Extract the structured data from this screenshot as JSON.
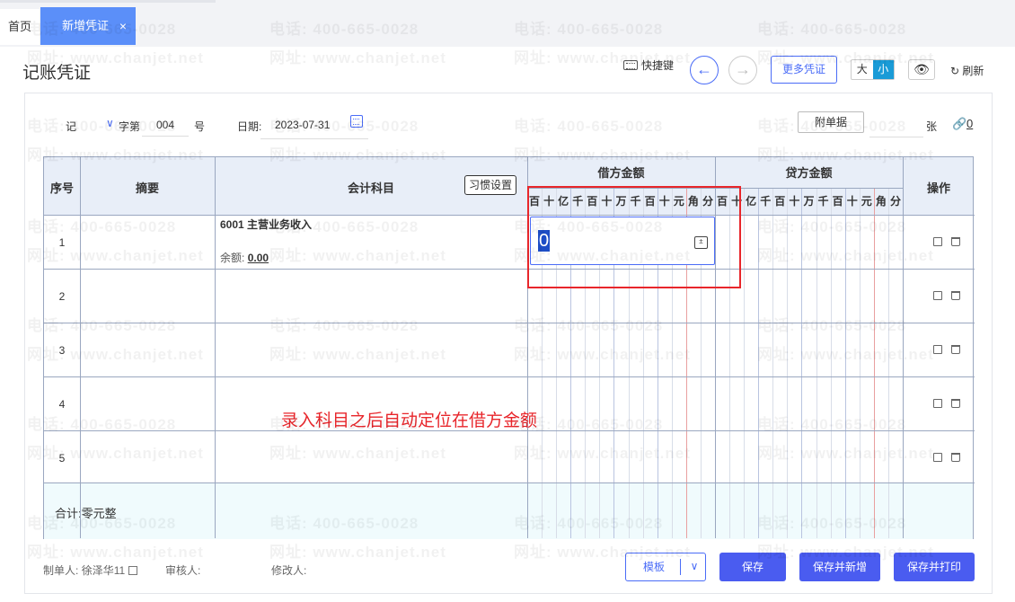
{
  "tabs": {
    "home": "首页",
    "active": "新增凭证",
    "close": "×"
  },
  "page": {
    "title": "记账凭证"
  },
  "toolbar": {
    "shortcut_label": "快捷键",
    "prev_icon": "←",
    "next_icon": "→",
    "more_vouchers": "更多凭证",
    "size_large": "大",
    "size_small": "小",
    "eye_icon": "👁",
    "refresh_label": "↻ 刷新"
  },
  "voucher": {
    "type": "记",
    "type_chevron": "∨",
    "zi_label": "字第",
    "number": "004",
    "hao_label": "号",
    "date_label": "日期:",
    "date": "2023-07-31",
    "attach_button": "附单据",
    "zhang_label": "张",
    "attach_icon": "🔗",
    "attach_count": "0"
  },
  "table": {
    "headers": {
      "seq": "序号",
      "summary": "摘要",
      "subject": "会计科目",
      "debit": "借方金额",
      "credit": "贷方金额",
      "ops": "操作",
      "habit_button": "习惯设置"
    },
    "digits": [
      "百",
      "十",
      "亿",
      "千",
      "百",
      "十",
      "万",
      "千",
      "百",
      "十",
      "元",
      "角",
      "分"
    ],
    "rows": [
      {
        "seq": "1",
        "subject": "6001 主营业务收入",
        "balance_label": "余额:",
        "balance": "0.00"
      },
      {
        "seq": "2"
      },
      {
        "seq": "3"
      },
      {
        "seq": "4"
      },
      {
        "seq": "5"
      }
    ],
    "debit_input_value": "0",
    "calc_icon": "±",
    "total": "合计:零元整"
  },
  "annotation": "录入科目之后自动定位在借方金额",
  "footer": {
    "maker_label": "制单人:",
    "maker": "徐泽华11",
    "reviewer_label": "审核人:",
    "modifier_label": "修改人:",
    "template_button": "模板",
    "template_chevron": "∨",
    "save_button": "保存",
    "save_new_button": "保存并新增",
    "save_print_button": "保存并打印"
  },
  "watermark": {
    "phone": "电话: 400-665-0028",
    "site": "网址: www.chanjet.net"
  },
  "colors": {
    "primary": "#4a5cf0",
    "tab_active": "#5b8ff9",
    "size_on": "#1a9bd7",
    "annotation": "#e8262b",
    "header_bg": "#e8eef8",
    "total_bg": "#f0fbfd"
  }
}
